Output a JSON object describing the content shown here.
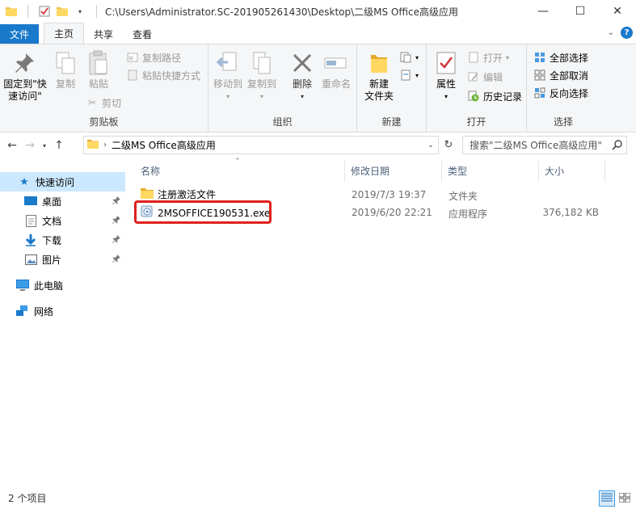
{
  "window": {
    "path_title": "C:\\Users\\Administrator.SC-201905261430\\Desktop\\二级MS Office高级应用",
    "minimize": "—",
    "maximize": "☐",
    "close": "✕"
  },
  "tabs": [
    {
      "label": "文件"
    },
    {
      "label": "主页"
    },
    {
      "label": "共享"
    },
    {
      "label": "查看"
    }
  ],
  "ribbon": {
    "clipboard": {
      "label": "剪贴板",
      "pin": "固定到\"快",
      "pin2": "速访问\"",
      "copy": "复制",
      "paste": "粘贴",
      "copy_path": "复制路径",
      "paste_shortcut": "粘贴快捷方式",
      "cut": "剪切"
    },
    "organize": {
      "label": "组织",
      "move_to": "移动到",
      "copy_to": "复制到",
      "delete": "删除",
      "rename": "重命名"
    },
    "new": {
      "label": "新建",
      "new_folder": "新建",
      "new_folder2": "文件夹"
    },
    "open": {
      "label": "打开",
      "properties": "属性",
      "open": "打开",
      "edit": "编辑",
      "history": "历史记录"
    },
    "select": {
      "label": "选择",
      "select_all": "全部选择",
      "select_none": "全部取消",
      "invert": "反向选择"
    }
  },
  "address": {
    "path": "二级MS Office高级应用",
    "search_placeholder": "搜索\"二级MS Office高级应用\""
  },
  "nav": {
    "quick_access": "快速访问",
    "desktop": "桌面",
    "documents": "文档",
    "downloads": "下载",
    "pictures": "图片",
    "this_pc": "此电脑",
    "network": "网络"
  },
  "columns": {
    "name": "名称",
    "modified": "修改日期",
    "type": "类型",
    "size": "大小"
  },
  "files": [
    {
      "name": "注册激活文件",
      "modified": "2019/7/3 19:37",
      "type": "文件夹",
      "size": ""
    },
    {
      "name": "2MSOFFICE190531.exe",
      "modified": "2019/6/20 22:21",
      "type": "应用程序",
      "size": "376,182 KB"
    }
  ],
  "status": {
    "item_count": "2 个项目"
  },
  "colors": {
    "accent": "#1979ca",
    "selection": "#cce8ff",
    "highlight": "#e0201c",
    "folder": "#f0c14b"
  }
}
